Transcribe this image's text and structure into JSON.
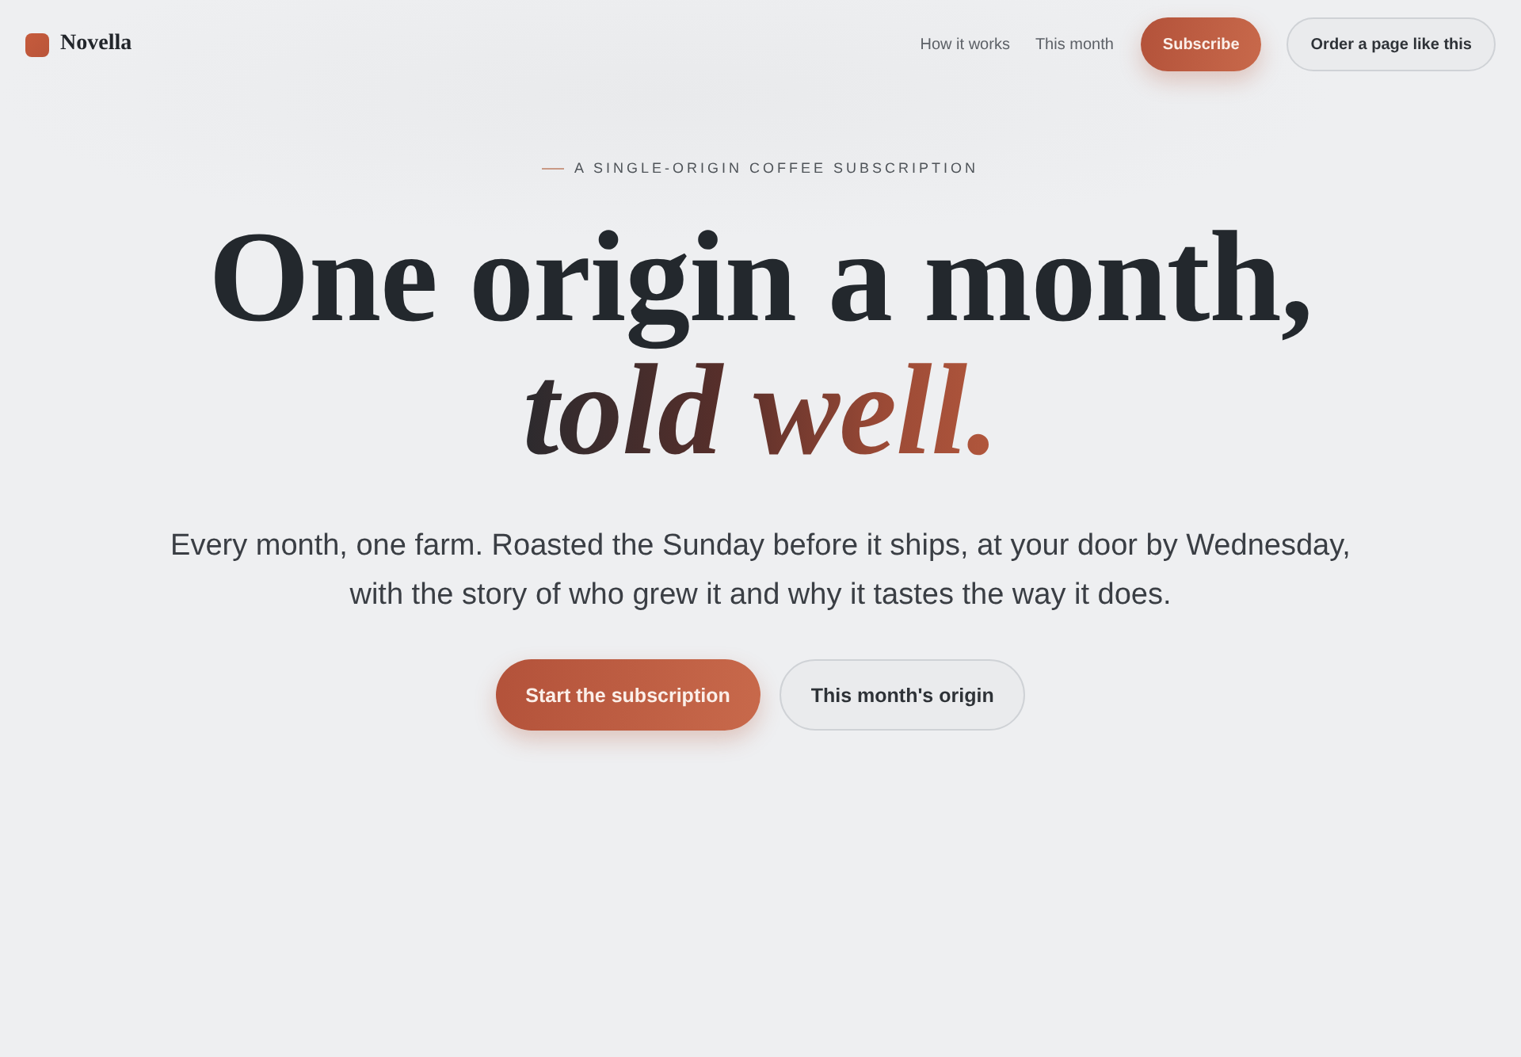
{
  "header": {
    "brand": "Novella",
    "nav_links": [
      "How it works",
      "This month"
    ],
    "buttons": [
      {
        "label": "Subscribe",
        "kind": "primary"
      },
      {
        "label": "Order a page like this",
        "kind": "secondary"
      }
    ]
  },
  "hero": {
    "eyebrow": "A SINGLE-ORIGIN COFFEE SUBSCRIPTION",
    "title": "One origin a month, *told well.*",
    "subtitle": "Every month, one farm. Roasted the Sunday before it ships, at your door by Wednesday, with the story of who grew it and why it tastes the way it does.",
    "buttons": [
      {
        "label": "Start the subscription",
        "kind": "primary"
      },
      {
        "label": "This month's origin",
        "kind": "secondary"
      }
    ]
  }
}
